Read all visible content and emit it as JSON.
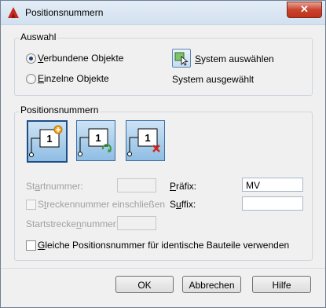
{
  "window": {
    "title": "Positionsnummern",
    "close_glyph": "✕"
  },
  "auswahl": {
    "label": "Auswahl",
    "radio_verbunden": {
      "prefix": "V",
      "rest": "erbundene Objekte",
      "checked": true
    },
    "radio_einzelne": {
      "prefix": "E",
      "rest": "inzelne Objekte",
      "checked": false
    },
    "system_button": {
      "prefix": "S",
      "rest": "ystem auswählen",
      "icon": "select-system-icon"
    },
    "system_status": "System ausgewählt"
  },
  "positionsnummern": {
    "label": "Positionsnummern",
    "buttons": [
      {
        "name": "add-position-number",
        "icon": "add-label-icon",
        "number": "1"
      },
      {
        "name": "renumber",
        "icon": "renumber-icon",
        "number": "1"
      },
      {
        "name": "delete-position-number",
        "icon": "delete-label-icon",
        "number": "1"
      }
    ],
    "startnummer": {
      "prefix": "St",
      "underlined": "a",
      "rest": "rtnummer:",
      "value": ""
    },
    "strecken_checkbox": {
      "prefix": "S",
      "underlined": "t",
      "rest": "reckennummer einschließen",
      "checked": false
    },
    "startstrecke": {
      "prefix": "Startstrecke",
      "underlined": "n",
      "rest": "nummer:",
      "value": ""
    },
    "praefix": {
      "underlined": "P",
      "rest": "räfix:",
      "value": "MV"
    },
    "suffix": {
      "prefix": "S",
      "underlined": "u",
      "rest": "ffix:",
      "value": ""
    },
    "gleiche_checkbox": {
      "underlined": "G",
      "rest": "leiche Positionsnummer für identische Bauteile verwenden",
      "checked": false
    }
  },
  "buttons": {
    "ok": "OK",
    "abbrechen": "Abbrechen",
    "hilfe": "Hilfe"
  },
  "colors": {
    "accent": "#1d4e86",
    "add_badge": "#f5a623",
    "renumber_arrow": "#3a9a3a",
    "delete_x": "#d0281f"
  }
}
